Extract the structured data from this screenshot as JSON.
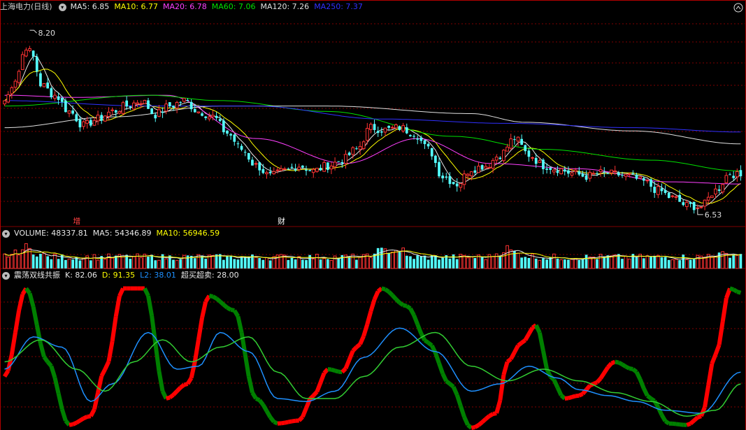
{
  "colors": {
    "up": "#ff3333",
    "down": "#54ffff",
    "grid": "#800000",
    "border": "#b00000",
    "ma5": "#e8e8e8",
    "ma10": "#ffff00",
    "ma20": "#ff40ff",
    "ma60": "#00e000",
    "ma120": "#e0e0e0",
    "ma250": "#3030ff",
    "k_up": "#ff0000",
    "k_down": "#008000",
    "d_line": "#1e90ff",
    "l2_line": "#32cd32"
  },
  "main_panel": {
    "title": "上海电力(日线)",
    "legend": [
      {
        "name": "MA5",
        "text": "MA5: 6.85",
        "color": "#e8e8e8"
      },
      {
        "name": "MA10",
        "text": "MA10: 6.77",
        "color": "#ffff00"
      },
      {
        "name": "MA20",
        "text": "MA20: 6.78",
        "color": "#ff40ff"
      },
      {
        "name": "MA60",
        "text": "MA60: 7.06",
        "color": "#00e000"
      },
      {
        "name": "MA120",
        "text": "MA120: 7.26",
        "color": "#e0e0e0"
      },
      {
        "name": "MA250",
        "text": "MA250: 7.37",
        "color": "#3030ff"
      }
    ],
    "high_label": "8.20",
    "low_label": "6.53",
    "markers": [
      {
        "text": "增",
        "color": "#ff4040"
      },
      {
        "text": "财",
        "color": "#ffffff"
      }
    ]
  },
  "volume_panel": {
    "legend": [
      {
        "name": "VOLUME",
        "text": "VOLUME: 48337.81",
        "color": "#e8e8e8"
      },
      {
        "name": "MA5",
        "text": "MA5: 54346.89",
        "color": "#e8e8e8"
      },
      {
        "name": "MA10",
        "text": "MA10: 56946.59",
        "color": "#ffff00"
      }
    ]
  },
  "indicator_panel": {
    "legend": [
      {
        "name": "title",
        "text": "震荡双线共振",
        "color": "#e8e8e8"
      },
      {
        "name": "K",
        "text": "K: 82.06",
        "color": "#e8e8e8"
      },
      {
        "name": "D",
        "text": "D: 91.35",
        "color": "#ffff00"
      },
      {
        "name": "L2",
        "text": "L2: 38.01",
        "color": "#1e90ff"
      },
      {
        "name": "overbought",
        "text": "超买超卖: 28.00",
        "color": "#e8e8e8"
      }
    ]
  },
  "chart_data": {
    "type": "candlestick",
    "price_ylim": [
      6.4,
      8.35
    ],
    "price_anchors": [
      [
        0,
        7.55
      ],
      [
        3,
        7.75
      ],
      [
        6,
        8.05
      ],
      [
        8,
        7.95
      ],
      [
        10,
        7.7
      ],
      [
        14,
        7.6
      ],
      [
        18,
        7.45
      ],
      [
        22,
        7.32
      ],
      [
        26,
        7.38
      ],
      [
        30,
        7.45
      ],
      [
        34,
        7.5
      ],
      [
        38,
        7.55
      ],
      [
        42,
        7.42
      ],
      [
        46,
        7.5
      ],
      [
        50,
        7.55
      ],
      [
        54,
        7.45
      ],
      [
        58,
        7.4
      ],
      [
        62,
        7.25
      ],
      [
        66,
        7.1
      ],
      [
        70,
        6.95
      ],
      [
        74,
        6.85
      ],
      [
        78,
        6.9
      ],
      [
        82,
        6.95
      ],
      [
        86,
        6.9
      ],
      [
        90,
        6.95
      ],
      [
        94,
        7.0
      ],
      [
        98,
        7.1
      ],
      [
        102,
        7.3
      ],
      [
        106,
        7.28
      ],
      [
        110,
        7.3
      ],
      [
        114,
        7.25
      ],
      [
        118,
        7.1
      ],
      [
        122,
        6.85
      ],
      [
        126,
        6.78
      ],
      [
        130,
        6.92
      ],
      [
        134,
        6.95
      ],
      [
        138,
        7.05
      ],
      [
        142,
        7.2
      ],
      [
        146,
        7.05
      ],
      [
        150,
        6.95
      ],
      [
        154,
        6.92
      ],
      [
        158,
        6.88
      ],
      [
        162,
        6.85
      ],
      [
        166,
        6.88
      ],
      [
        170,
        6.87
      ],
      [
        174,
        6.85
      ],
      [
        178,
        6.8
      ],
      [
        182,
        6.72
      ],
      [
        186,
        6.65
      ],
      [
        190,
        6.58
      ],
      [
        194,
        6.57
      ],
      [
        198,
        6.72
      ],
      [
        202,
        6.88
      ],
      [
        205,
        6.85
      ]
    ],
    "ma_anchors": {
      "ma20": [
        [
          0,
          7.6
        ],
        [
          20,
          7.58
        ],
        [
          45,
          7.6
        ],
        [
          70,
          7.2
        ],
        [
          95,
          6.97
        ],
        [
          115,
          7.2
        ],
        [
          135,
          6.97
        ],
        [
          160,
          6.92
        ],
        [
          185,
          6.8
        ],
        [
          205,
          6.78
        ]
      ],
      "ma60": [
        [
          0,
          7.5
        ],
        [
          40,
          7.6
        ],
        [
          60,
          7.55
        ],
        [
          90,
          7.45
        ],
        [
          125,
          7.22
        ],
        [
          150,
          7.1
        ],
        [
          180,
          7.0
        ],
        [
          205,
          6.9
        ]
      ],
      "ma120": [
        [
          0,
          7.3
        ],
        [
          30,
          7.4
        ],
        [
          60,
          7.5
        ],
        [
          90,
          7.5
        ],
        [
          130,
          7.43
        ],
        [
          145,
          7.35
        ],
        [
          175,
          7.27
        ],
        [
          205,
          7.15
        ]
      ],
      "ma250": [
        [
          0,
          7.55
        ],
        [
          40,
          7.5
        ],
        [
          70,
          7.5
        ],
        [
          105,
          7.38
        ],
        [
          140,
          7.34
        ],
        [
          175,
          7.3
        ],
        [
          205,
          7.26
        ]
      ]
    },
    "oscillator": {
      "k_anchors": [
        [
          0,
          35
        ],
        [
          6,
          95
        ],
        [
          12,
          45
        ],
        [
          18,
          2
        ],
        [
          24,
          8
        ],
        [
          28,
          40
        ],
        [
          33,
          95
        ],
        [
          39,
          95
        ],
        [
          45,
          20
        ],
        [
          51,
          30
        ],
        [
          57,
          90
        ],
        [
          64,
          80
        ],
        [
          70,
          20
        ],
        [
          76,
          3
        ],
        [
          82,
          5
        ],
        [
          86,
          22
        ],
        [
          90,
          40
        ],
        [
          94,
          38
        ],
        [
          98,
          55
        ],
        [
          105,
          95
        ],
        [
          112,
          83
        ],
        [
          118,
          58
        ],
        [
          124,
          30
        ],
        [
          130,
          0
        ],
        [
          137,
          10
        ],
        [
          140,
          45
        ],
        [
          144,
          58
        ],
        [
          148,
          70
        ],
        [
          152,
          35
        ],
        [
          156,
          20
        ],
        [
          160,
          22
        ],
        [
          164,
          30
        ],
        [
          170,
          45
        ],
        [
          175,
          40
        ],
        [
          180,
          20
        ],
        [
          185,
          3
        ],
        [
          190,
          2
        ],
        [
          194,
          8
        ],
        [
          198,
          50
        ],
        [
          202,
          95
        ],
        [
          205,
          92
        ]
      ],
      "d_anchors": [
        [
          0,
          40
        ],
        [
          8,
          62
        ],
        [
          16,
          55
        ],
        [
          24,
          18
        ],
        [
          30,
          30
        ],
        [
          40,
          65
        ],
        [
          48,
          40
        ],
        [
          54,
          42
        ],
        [
          60,
          65
        ],
        [
          68,
          52
        ],
        [
          76,
          20
        ],
        [
          84,
          18
        ],
        [
          92,
          25
        ],
        [
          100,
          48
        ],
        [
          110,
          68
        ],
        [
          120,
          52
        ],
        [
          130,
          25
        ],
        [
          138,
          30
        ],
        [
          146,
          42
        ],
        [
          154,
          34
        ],
        [
          160,
          26
        ],
        [
          168,
          22
        ],
        [
          176,
          18
        ],
        [
          184,
          12
        ],
        [
          194,
          10
        ],
        [
          205,
          38
        ]
      ],
      "l2_anchors": [
        [
          0,
          45
        ],
        [
          10,
          60
        ],
        [
          20,
          40
        ],
        [
          28,
          25
        ],
        [
          36,
          45
        ],
        [
          44,
          60
        ],
        [
          52,
          45
        ],
        [
          60,
          55
        ],
        [
          68,
          62
        ],
        [
          76,
          38
        ],
        [
          84,
          20
        ],
        [
          92,
          20
        ],
        [
          100,
          35
        ],
        [
          110,
          55
        ],
        [
          120,
          65
        ],
        [
          130,
          42
        ],
        [
          140,
          32
        ],
        [
          150,
          40
        ],
        [
          160,
          32
        ],
        [
          170,
          24
        ],
        [
          180,
          18
        ],
        [
          190,
          8
        ],
        [
          198,
          12
        ],
        [
          205,
          30
        ]
      ],
      "ylim": [
        0,
        100
      ]
    },
    "volume_ylim": [
      0,
      110000
    ],
    "n_bars": 206
  }
}
